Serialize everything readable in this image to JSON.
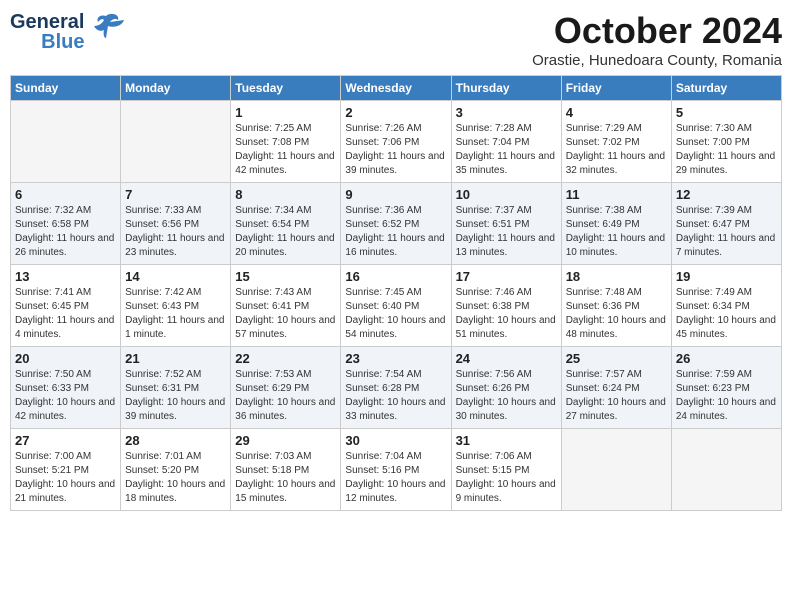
{
  "header": {
    "logo_text1": "General",
    "logo_text2": "Blue",
    "month": "October 2024",
    "location": "Orastie, Hunedoara County, Romania"
  },
  "days_of_week": [
    "Sunday",
    "Monday",
    "Tuesday",
    "Wednesday",
    "Thursday",
    "Friday",
    "Saturday"
  ],
  "weeks": [
    [
      {
        "num": "",
        "info": "",
        "empty": true
      },
      {
        "num": "",
        "info": "",
        "empty": true
      },
      {
        "num": "1",
        "info": "Sunrise: 7:25 AM\nSunset: 7:08 PM\nDaylight: 11 hours and 42 minutes.",
        "empty": false
      },
      {
        "num": "2",
        "info": "Sunrise: 7:26 AM\nSunset: 7:06 PM\nDaylight: 11 hours and 39 minutes.",
        "empty": false
      },
      {
        "num": "3",
        "info": "Sunrise: 7:28 AM\nSunset: 7:04 PM\nDaylight: 11 hours and 35 minutes.",
        "empty": false
      },
      {
        "num": "4",
        "info": "Sunrise: 7:29 AM\nSunset: 7:02 PM\nDaylight: 11 hours and 32 minutes.",
        "empty": false
      },
      {
        "num": "5",
        "info": "Sunrise: 7:30 AM\nSunset: 7:00 PM\nDaylight: 11 hours and 29 minutes.",
        "empty": false
      }
    ],
    [
      {
        "num": "6",
        "info": "Sunrise: 7:32 AM\nSunset: 6:58 PM\nDaylight: 11 hours and 26 minutes.",
        "empty": false
      },
      {
        "num": "7",
        "info": "Sunrise: 7:33 AM\nSunset: 6:56 PM\nDaylight: 11 hours and 23 minutes.",
        "empty": false
      },
      {
        "num": "8",
        "info": "Sunrise: 7:34 AM\nSunset: 6:54 PM\nDaylight: 11 hours and 20 minutes.",
        "empty": false
      },
      {
        "num": "9",
        "info": "Sunrise: 7:36 AM\nSunset: 6:52 PM\nDaylight: 11 hours and 16 minutes.",
        "empty": false
      },
      {
        "num": "10",
        "info": "Sunrise: 7:37 AM\nSunset: 6:51 PM\nDaylight: 11 hours and 13 minutes.",
        "empty": false
      },
      {
        "num": "11",
        "info": "Sunrise: 7:38 AM\nSunset: 6:49 PM\nDaylight: 11 hours and 10 minutes.",
        "empty": false
      },
      {
        "num": "12",
        "info": "Sunrise: 7:39 AM\nSunset: 6:47 PM\nDaylight: 11 hours and 7 minutes.",
        "empty": false
      }
    ],
    [
      {
        "num": "13",
        "info": "Sunrise: 7:41 AM\nSunset: 6:45 PM\nDaylight: 11 hours and 4 minutes.",
        "empty": false
      },
      {
        "num": "14",
        "info": "Sunrise: 7:42 AM\nSunset: 6:43 PM\nDaylight: 11 hours and 1 minute.",
        "empty": false
      },
      {
        "num": "15",
        "info": "Sunrise: 7:43 AM\nSunset: 6:41 PM\nDaylight: 10 hours and 57 minutes.",
        "empty": false
      },
      {
        "num": "16",
        "info": "Sunrise: 7:45 AM\nSunset: 6:40 PM\nDaylight: 10 hours and 54 minutes.",
        "empty": false
      },
      {
        "num": "17",
        "info": "Sunrise: 7:46 AM\nSunset: 6:38 PM\nDaylight: 10 hours and 51 minutes.",
        "empty": false
      },
      {
        "num": "18",
        "info": "Sunrise: 7:48 AM\nSunset: 6:36 PM\nDaylight: 10 hours and 48 minutes.",
        "empty": false
      },
      {
        "num": "19",
        "info": "Sunrise: 7:49 AM\nSunset: 6:34 PM\nDaylight: 10 hours and 45 minutes.",
        "empty": false
      }
    ],
    [
      {
        "num": "20",
        "info": "Sunrise: 7:50 AM\nSunset: 6:33 PM\nDaylight: 10 hours and 42 minutes.",
        "empty": false
      },
      {
        "num": "21",
        "info": "Sunrise: 7:52 AM\nSunset: 6:31 PM\nDaylight: 10 hours and 39 minutes.",
        "empty": false
      },
      {
        "num": "22",
        "info": "Sunrise: 7:53 AM\nSunset: 6:29 PM\nDaylight: 10 hours and 36 minutes.",
        "empty": false
      },
      {
        "num": "23",
        "info": "Sunrise: 7:54 AM\nSunset: 6:28 PM\nDaylight: 10 hours and 33 minutes.",
        "empty": false
      },
      {
        "num": "24",
        "info": "Sunrise: 7:56 AM\nSunset: 6:26 PM\nDaylight: 10 hours and 30 minutes.",
        "empty": false
      },
      {
        "num": "25",
        "info": "Sunrise: 7:57 AM\nSunset: 6:24 PM\nDaylight: 10 hours and 27 minutes.",
        "empty": false
      },
      {
        "num": "26",
        "info": "Sunrise: 7:59 AM\nSunset: 6:23 PM\nDaylight: 10 hours and 24 minutes.",
        "empty": false
      }
    ],
    [
      {
        "num": "27",
        "info": "Sunrise: 7:00 AM\nSunset: 5:21 PM\nDaylight: 10 hours and 21 minutes.",
        "empty": false
      },
      {
        "num": "28",
        "info": "Sunrise: 7:01 AM\nSunset: 5:20 PM\nDaylight: 10 hours and 18 minutes.",
        "empty": false
      },
      {
        "num": "29",
        "info": "Sunrise: 7:03 AM\nSunset: 5:18 PM\nDaylight: 10 hours and 15 minutes.",
        "empty": false
      },
      {
        "num": "30",
        "info": "Sunrise: 7:04 AM\nSunset: 5:16 PM\nDaylight: 10 hours and 12 minutes.",
        "empty": false
      },
      {
        "num": "31",
        "info": "Sunrise: 7:06 AM\nSunset: 5:15 PM\nDaylight: 10 hours and 9 minutes.",
        "empty": false
      },
      {
        "num": "",
        "info": "",
        "empty": true
      },
      {
        "num": "",
        "info": "",
        "empty": true
      }
    ]
  ]
}
